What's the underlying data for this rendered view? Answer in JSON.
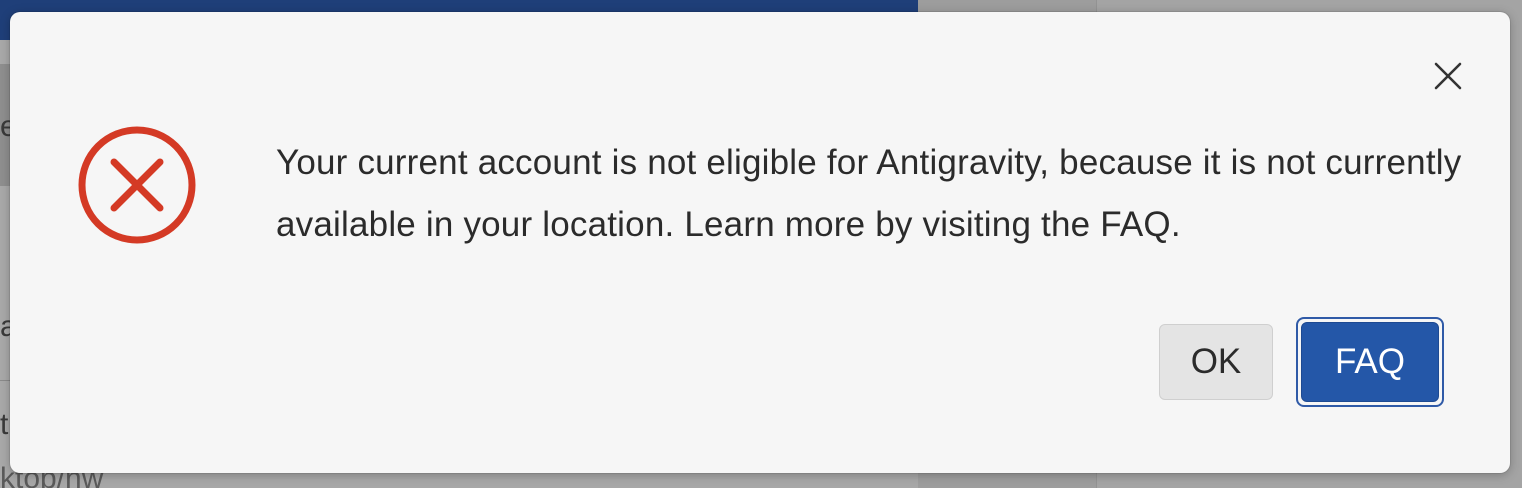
{
  "background": {
    "fragments": [
      "er",
      "a",
      "t",
      "ktop/nw"
    ]
  },
  "dialog": {
    "message": "Your current account is not eligible for Antigravity, because it is not currently available in your location. Learn more by visiting the FAQ.",
    "icon": "error-circle-x-icon",
    "icon_color": "#d43a25",
    "close_icon": "close-icon",
    "buttons": {
      "ok_label": "OK",
      "faq_label": "FAQ"
    },
    "accent_color": "#2457a8"
  }
}
